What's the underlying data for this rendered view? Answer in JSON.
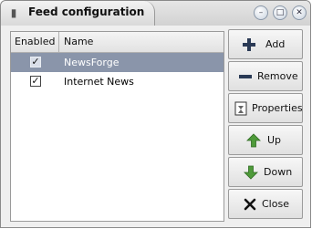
{
  "window": {
    "title": "Feed configuration",
    "buttons": [
      "minimize-icon",
      "maximize-icon",
      "close-icon"
    ]
  },
  "list": {
    "headers": {
      "enabled": "Enabled",
      "name": "Name"
    },
    "rows": [
      {
        "enabled": true,
        "name": "NewsForge",
        "selected": true
      },
      {
        "enabled": true,
        "name": "Internet News",
        "selected": false
      }
    ]
  },
  "actions": {
    "add": "Add",
    "remove": "Remove",
    "properties": "Properties",
    "up": "Up",
    "down": "Down",
    "close": "Close"
  },
  "colors": {
    "selection": "#8a95aa",
    "window_bg": "#efefef",
    "arrow_green": "#4e9a3a"
  }
}
